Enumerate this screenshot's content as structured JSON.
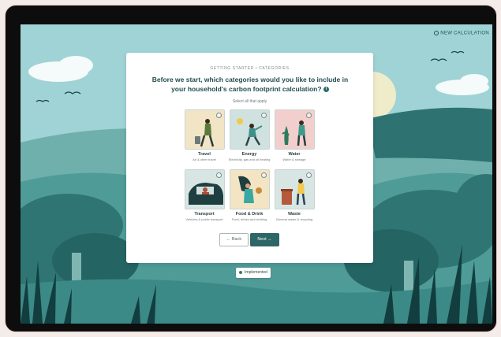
{
  "header": {
    "calculator_link": "NEW CALCULATION"
  },
  "card": {
    "eyebrow": "GETTING STARTED • CATEGORIES",
    "heading": "Before we start, which categories would you like to include in your household's carbon footprint calculation?",
    "info_icon": "i",
    "hint": "Select all that apply"
  },
  "categories": [
    {
      "label": "Travel",
      "sublabel": "Air & other travel",
      "icon": "traveler-with-suitcase"
    },
    {
      "label": "Energy",
      "sublabel": "Electricity, gas and oil heating",
      "icon": "person-under-sun"
    },
    {
      "label": "Water",
      "sublabel": "Water & sewage",
      "icon": "person-watering-plant"
    },
    {
      "label": "Transport",
      "sublabel": "Vehicles & public transport",
      "icon": "person-in-car"
    },
    {
      "label": "Food & Drink",
      "sublabel": "Food, drinks and clothing",
      "icon": "person-with-groceries"
    },
    {
      "label": "Waste",
      "sublabel": "General waste & recycling",
      "icon": "person-with-bin"
    }
  ],
  "buttons": {
    "back": "← Back",
    "next": "Next →"
  },
  "footer_pill": "Implemented",
  "colors": {
    "sky": "#9bd0d2",
    "hills": "#4e9c9b",
    "dark_teal": "#1f5f60",
    "primary_button": "#2d6667"
  }
}
